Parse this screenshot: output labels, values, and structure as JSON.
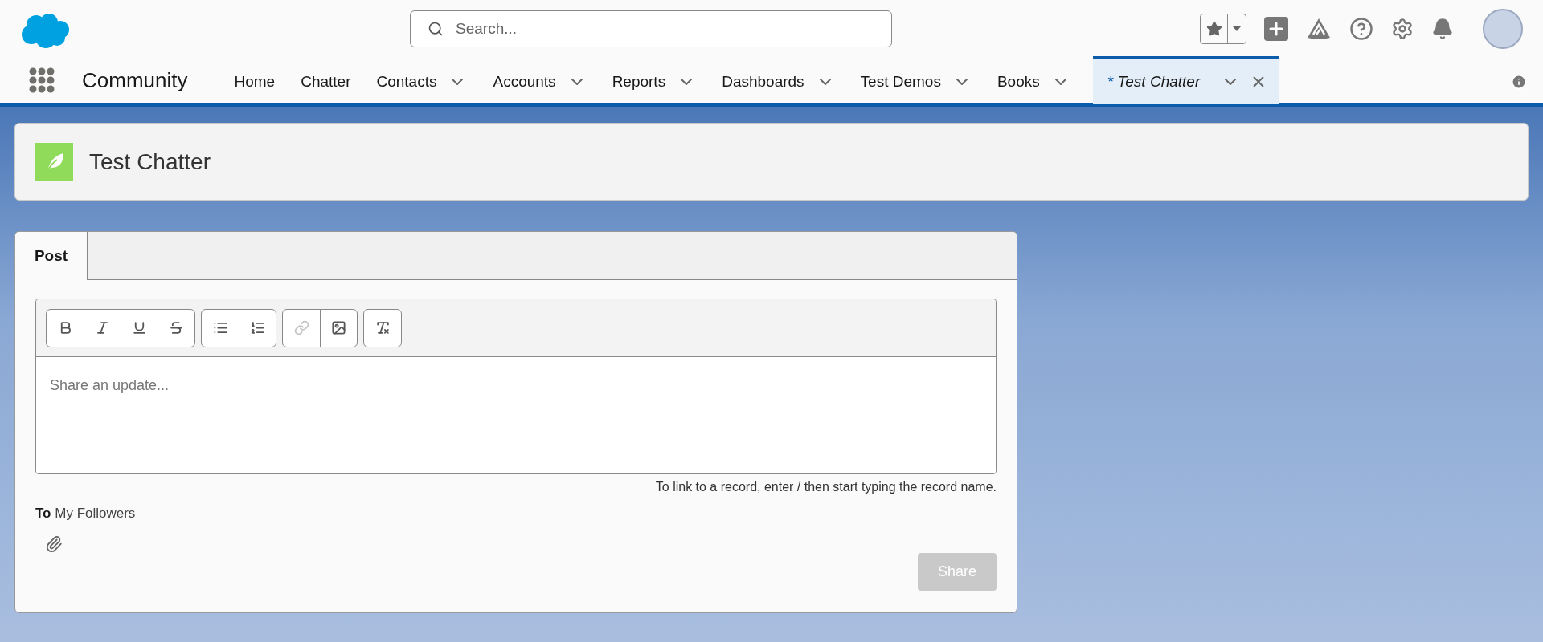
{
  "search": {
    "placeholder": "Search..."
  },
  "app_name": "Community",
  "nav_items": [
    {
      "label": "Home",
      "has_menu": false,
      "selected": false
    },
    {
      "label": "Chatter",
      "has_menu": false,
      "selected": false
    },
    {
      "label": "Contacts",
      "has_menu": true,
      "selected": false
    },
    {
      "label": "Accounts",
      "has_menu": true,
      "selected": false
    },
    {
      "label": "Reports",
      "has_menu": true,
      "selected": false
    },
    {
      "label": "Dashboards",
      "has_menu": true,
      "selected": false
    },
    {
      "label": "Test Demos",
      "has_menu": true,
      "selected": false
    },
    {
      "label": "Books",
      "has_menu": true,
      "selected": false
    }
  ],
  "open_tab": {
    "unsaved_mark": "*",
    "label": "Test Chatter",
    "selected": true
  },
  "page_header": {
    "title": "Test Chatter"
  },
  "publisher": {
    "tabs": [
      {
        "label": "Post",
        "selected": true
      }
    ],
    "toolbar_groups": [
      [
        {
          "kind": "bold",
          "disabled": false
        },
        {
          "kind": "italic",
          "disabled": false
        },
        {
          "kind": "underline",
          "disabled": false
        },
        {
          "kind": "strike",
          "disabled": false
        }
      ],
      [
        {
          "kind": "bullets",
          "disabled": false
        },
        {
          "kind": "numbers",
          "disabled": false
        }
      ],
      [
        {
          "kind": "link",
          "disabled": true
        },
        {
          "kind": "image",
          "disabled": false
        }
      ],
      [
        {
          "kind": "clear",
          "disabled": false
        }
      ]
    ],
    "placeholder": "Share an update...",
    "hint": "To link to a record, enter / then start typing the record name.",
    "to_label": "To",
    "audience": "My Followers",
    "share_button": {
      "label": "Share",
      "disabled": true
    }
  }
}
